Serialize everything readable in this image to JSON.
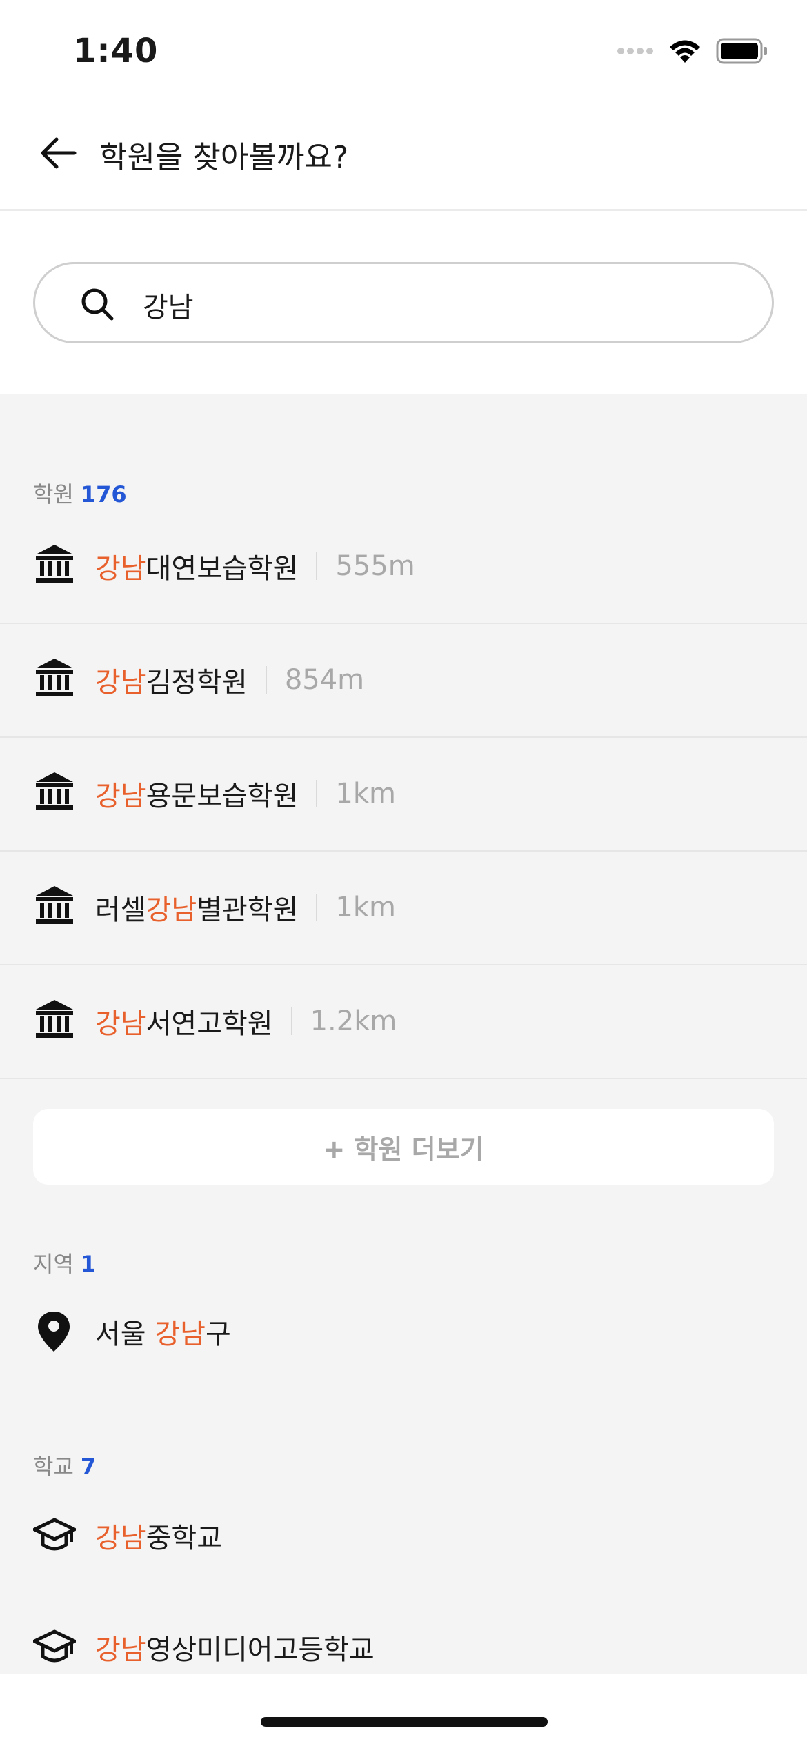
{
  "status_bar": {
    "time": "1:40"
  },
  "nav": {
    "title": "학원을 찾아볼까요?"
  },
  "search": {
    "value": "강남",
    "placeholder": ""
  },
  "academy_section": {
    "label": "학원",
    "count": "176",
    "items": [
      {
        "prefix": "",
        "highlight": "강남",
        "suffix": "대연보습학원",
        "distance": "555m"
      },
      {
        "prefix": "",
        "highlight": "강남",
        "suffix": "김정학원",
        "distance": "854m"
      },
      {
        "prefix": "",
        "highlight": "강남",
        "suffix": "용문보습학원",
        "distance": "1km"
      },
      {
        "prefix": "러셀",
        "highlight": "강남",
        "suffix": "별관학원",
        "distance": "1km"
      },
      {
        "prefix": "",
        "highlight": "강남",
        "suffix": "서연고학원",
        "distance": "1.2km"
      }
    ],
    "more_label": "+ 학원 더보기"
  },
  "region_section": {
    "label": "지역",
    "count": "1",
    "items": [
      {
        "prefix": "서울 ",
        "highlight": "강남",
        "suffix": "구"
      }
    ]
  },
  "school_section": {
    "label": "학교",
    "count": "7",
    "items": [
      {
        "prefix": "",
        "highlight": "강남",
        "suffix": "중학교"
      },
      {
        "prefix": "",
        "highlight": "강남",
        "suffix": "영상미디어고등학교"
      }
    ]
  },
  "colors": {
    "highlight": "#e8602c",
    "count": "#2457d6",
    "distance": "#a8a8a8"
  },
  "icons": {
    "academy": "academy-building-icon",
    "region": "location-pin-icon",
    "school": "graduation-cap-icon"
  }
}
